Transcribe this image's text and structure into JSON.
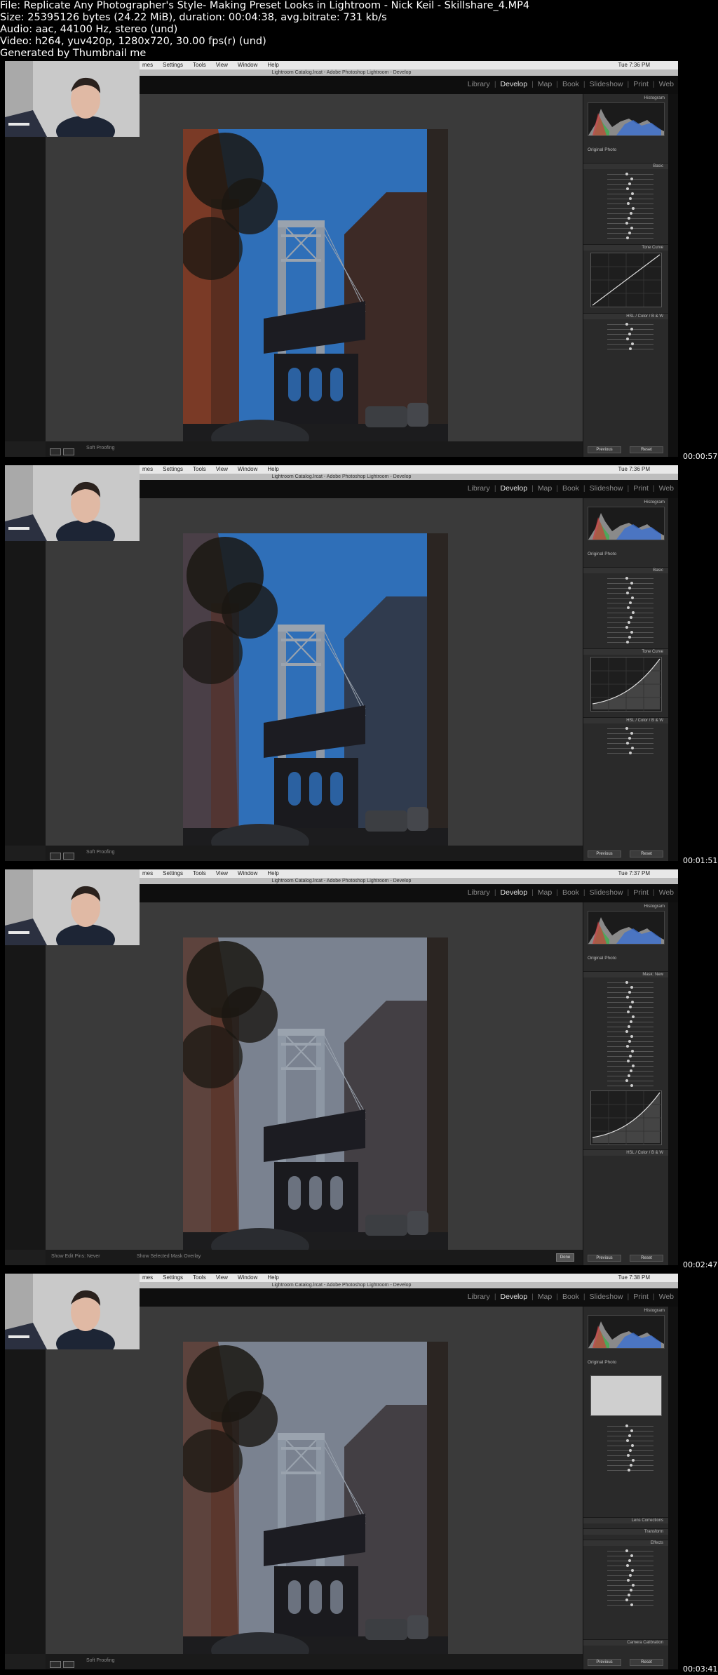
{
  "header": {
    "file": "File: Replicate Any Photographer's Style- Making Preset Looks in Lightroom - Nick Keil - Skillshare_4.MP4",
    "size": "Size: 25395126 bytes (24.22 MiB), duration: 00:04:38, avg.bitrate: 731 kb/s",
    "audio": "Audio: aac, 44100 Hz, stereo (und)",
    "video": "Video: h264, yuv420p, 1280x720, 30.00 fps(r) (und)",
    "generated": "Generated by Thumbnail me"
  },
  "app": {
    "mac_menus": [
      "mes",
      "Settings",
      "Tools",
      "View",
      "Window",
      "Help"
    ],
    "window_title": "Lightroom Catalog.lrcat - Adobe Photoshop Lightroom - Develop",
    "modules": [
      "Library",
      "Develop",
      "Map",
      "Book",
      "Slideshow",
      "Print",
      "Web"
    ],
    "active_module": "Develop",
    "histogram_label": "Histogram",
    "original_photo_label": "Original Photo",
    "panels": [
      "Basic",
      "Tone Curve",
      "HSL / Color / B & W"
    ],
    "previous_label": "Previous",
    "reset_label": "Reset",
    "soft_proofing_label": "Soft Proofing",
    "brush_panel_label": "Mask: New",
    "effects_panel_label": "Effects",
    "lens_corrections_label": "Lens Corrections",
    "transform_label": "Transform",
    "camera_calibration_label": "Camera Calibration",
    "show_edit_pins_label": "Show Edit Pins: Never",
    "show_mask_overlay_label": "Show Selected Mask Overlay",
    "done_label": "Done"
  },
  "frames": [
    {
      "clock": "Tue 7:36 PM",
      "timestamp": "00:00:57",
      "variant": "basic"
    },
    {
      "clock": "Tue 7:36 PM",
      "timestamp": "00:01:51",
      "variant": "curve"
    },
    {
      "clock": "Tue 7:37 PM",
      "timestamp": "00:02:47",
      "variant": "brush"
    },
    {
      "clock": "Tue 7:38 PM",
      "timestamp": "00:03:41",
      "variant": "effects"
    }
  ],
  "colors": {
    "sky_blue": "#2f6fb8",
    "sky_grey": "#7a8290",
    "brick": "#7a3a26",
    "panel_bg": "#2a2a2a",
    "canvas_bg": "#3a3a3a"
  }
}
